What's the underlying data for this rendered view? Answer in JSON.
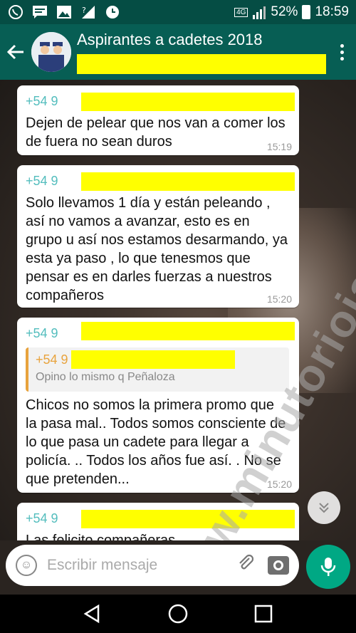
{
  "status_bar": {
    "network": "4G",
    "battery": "52%",
    "time": "18:59",
    "icons": [
      "whatsapp-icon",
      "message-icon",
      "image-icon",
      "signal-question-icon",
      "clock-icon"
    ]
  },
  "header": {
    "back_icon": "arrow-left-icon",
    "title": "Aspirantes a cadetes 2018",
    "menu_icon": "more-vert-icon"
  },
  "messages": [
    {
      "sender": "+54 9",
      "text": "Dejen de pelear que nos van a comer los de fuera no sean duros",
      "time": "15:19"
    },
    {
      "sender": "+54 9",
      "text": "Solo llevamos 1 día y están peleando , así no vamos a avanzar, esto es en grupo u así nos estamos desarmando,  ya esta ya paso , lo que tenesmos que pensar es en darles fuerzas a nuestros compañeros",
      "time": "15:20"
    },
    {
      "sender": "+54 9",
      "quote": {
        "sender": "+54 9",
        "text": "Opino lo mismo q Peñaloza"
      },
      "text": "Chicos no somos la primera promo que la pasa mal.. Todos somos consciente de lo que pasa un cadete para llegar a policía. .. Todos los años fue así. . No se que pretenden...",
      "time": "15:20"
    },
    {
      "sender": "+54 9",
      "text": "Las felicito compañeras"
    }
  ],
  "watermark": "www.minutoriojas.com.ar",
  "input": {
    "placeholder": "Escribir mensaje"
  },
  "colors": {
    "header": "#075e54",
    "status_bar": "#054d44",
    "accent": "#00a884",
    "sender": "#53bdbd",
    "quote_accent": "#e8a33d",
    "redaction": "#ffff00"
  }
}
